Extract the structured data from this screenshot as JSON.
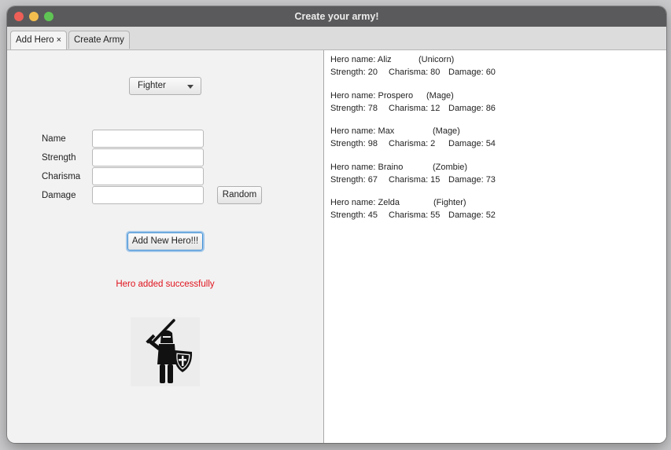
{
  "window": {
    "title": "Create your army!"
  },
  "tabs": [
    {
      "label": "Add Hero",
      "close": "×",
      "active": true
    },
    {
      "label": "Create Army",
      "active": false
    }
  ],
  "form": {
    "hero_type": "Fighter",
    "fields": [
      {
        "label": "Name",
        "value": ""
      },
      {
        "label": "Strength",
        "value": ""
      },
      {
        "label": "Charisma",
        "value": ""
      },
      {
        "label": "Damage",
        "value": ""
      }
    ],
    "random_label": "Random",
    "add_label": "Add New Hero!!!",
    "status": "Hero added successfully",
    "status_color": "#e0131d",
    "hero_icon": "fighter-knight-icon"
  },
  "heroes": [
    {
      "name": "Hero name: Aliz",
      "type": "(Unicorn)",
      "strength": "Strength: 20",
      "charisma": "Charisma: 80",
      "damage": "Damage: 60"
    },
    {
      "name": "Hero name: Prospero",
      "type": "(Mage)",
      "strength": "Strength: 78",
      "charisma": "Charisma: 12",
      "damage": "Damage: 86"
    },
    {
      "name": "Hero name: Max",
      "type": "(Mage)",
      "strength": "Strength: 98",
      "charisma": "Charisma: 2",
      "damage": "Damage: 54"
    },
    {
      "name": "Hero name: Braino",
      "type": "(Zombie)",
      "strength": "Strength: 67",
      "charisma": "Charisma: 15",
      "damage": "Damage: 73"
    },
    {
      "name": "Hero name: Zelda",
      "type": "(Fighter)",
      "strength": "Strength: 45",
      "charisma": "Charisma: 55",
      "damage": "Damage: 52"
    }
  ]
}
